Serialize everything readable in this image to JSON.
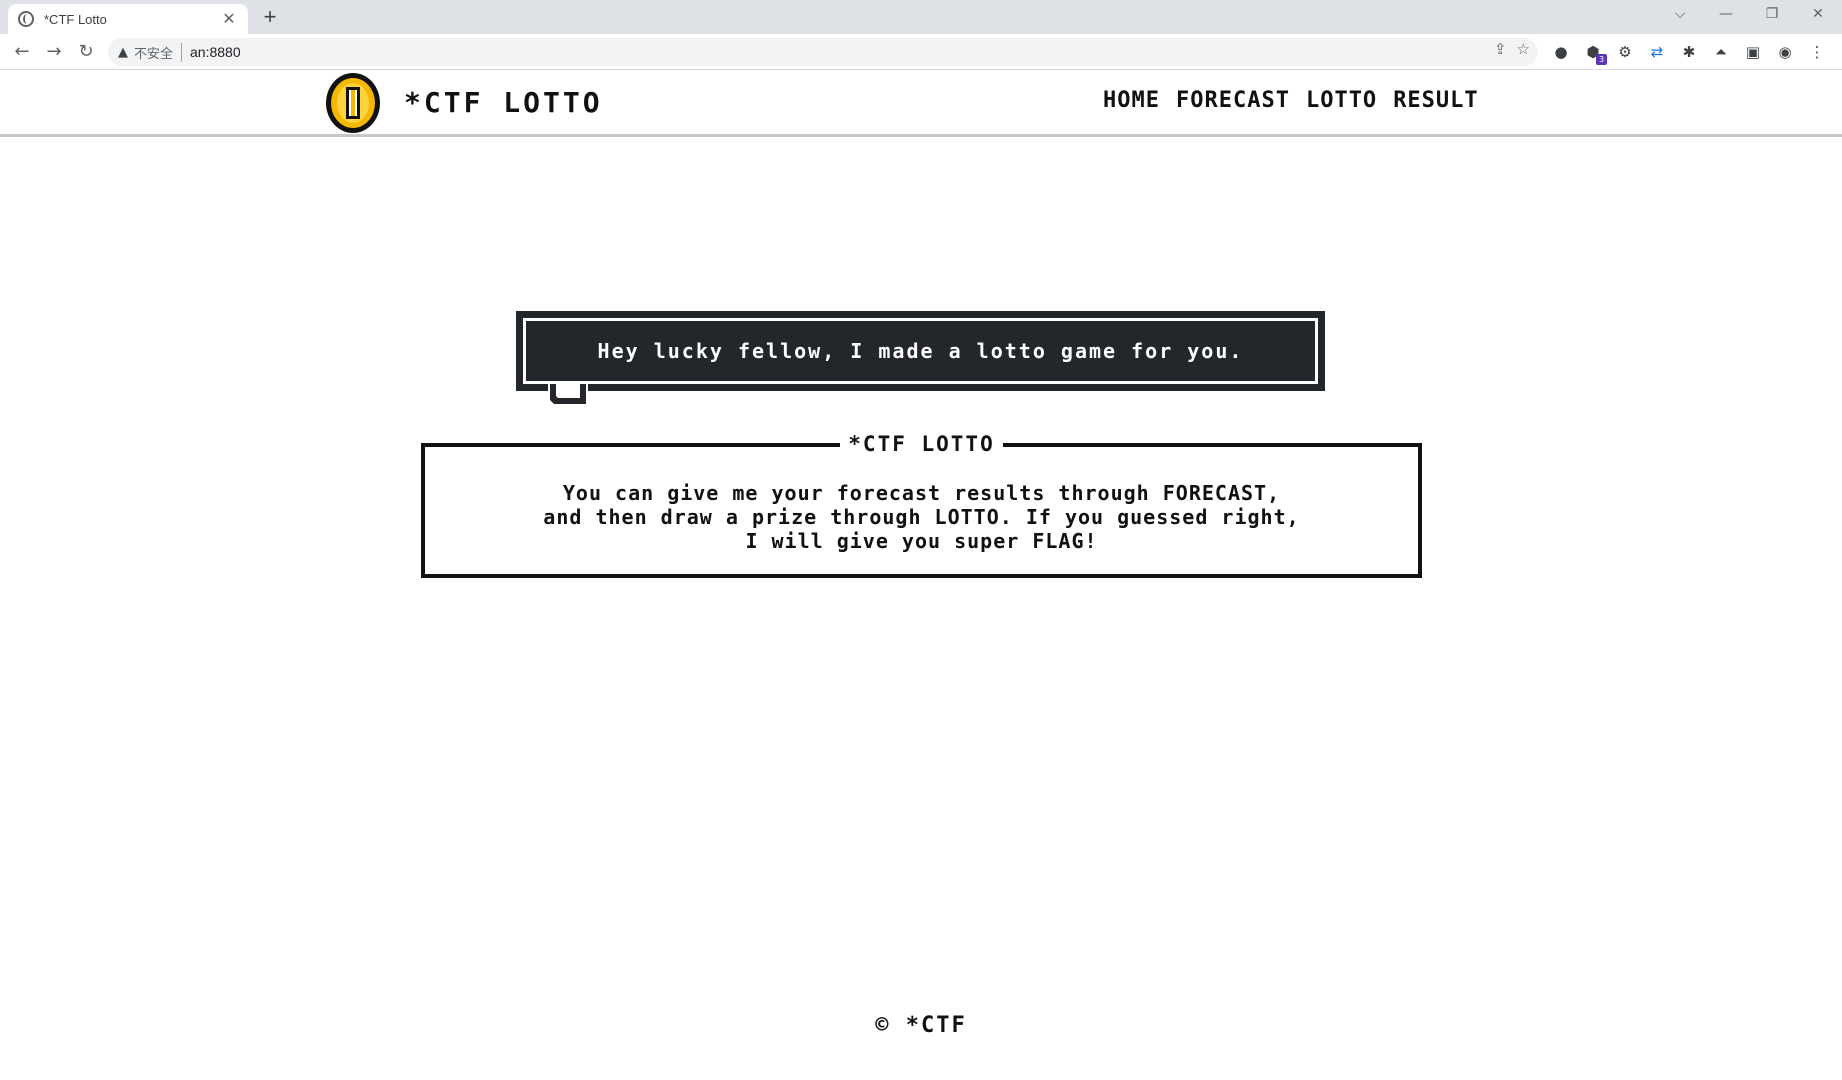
{
  "browser": {
    "tab_title": "*CTF Lotto",
    "tab_close": "✕",
    "new_tab": "+",
    "window_controls": {
      "chevron": "⌵",
      "minimize": "—",
      "restore": "❐",
      "close": "✕"
    },
    "nav": {
      "back": "←",
      "forward": "→",
      "reload": "↻"
    },
    "omnibox": {
      "warning_icon": "▲",
      "insecure_label": "不安全",
      "url": "an:8880"
    },
    "omnibox_icons": {
      "share": "⇪",
      "bookmark": "☆"
    },
    "extensions": [
      {
        "name": "circle-extension-icon",
        "glyph": "●"
      },
      {
        "name": "hexagon-extension-icon",
        "glyph": "⬢",
        "badge": "3"
      },
      {
        "name": "gear-extension-icon",
        "glyph": "⚙"
      },
      {
        "name": "sync-extension-icon",
        "glyph": "⇄"
      },
      {
        "name": "puzzle-extension-icon",
        "glyph": "✱"
      },
      {
        "name": "flask-extension-icon",
        "glyph": "⏶"
      },
      {
        "name": "sidepanel-icon",
        "glyph": "▣"
      },
      {
        "name": "profile-icon",
        "glyph": "◉"
      },
      {
        "name": "menu-icon",
        "glyph": "⋮"
      }
    ]
  },
  "site": {
    "title": "*CTF LOTTO",
    "nav": [
      "HOME",
      "FORECAST",
      "LOTTO",
      "RESULT"
    ]
  },
  "bubble": {
    "text": "Hey lucky fellow, I made a lotto game for you."
  },
  "card": {
    "legend": "*CTF LOTTO",
    "lines": [
      "You can give me your forecast results through FORECAST,",
      "and then draw a prize through LOTTO. If you guessed right,",
      "I will give you super FLAG!"
    ]
  },
  "footer": {
    "text": "© *CTF"
  },
  "colors": {
    "bubble_bg": "#23262b",
    "coin_gold": "#f5b800",
    "coin_outline": "#111111",
    "tabstrip": "#dee1e6"
  }
}
